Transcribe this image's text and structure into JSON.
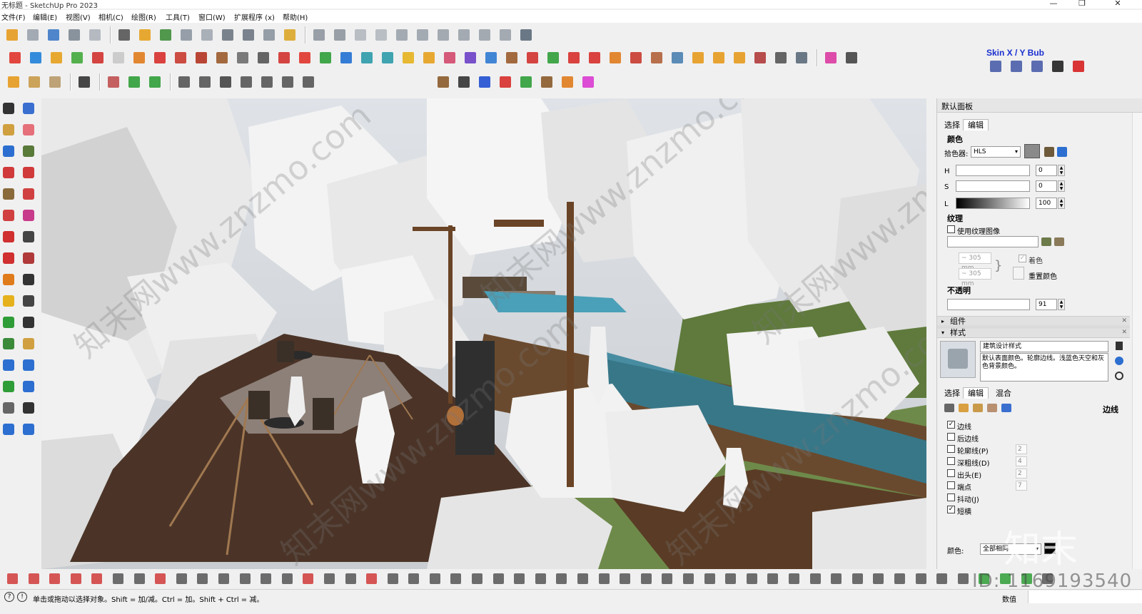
{
  "window": {
    "title": "无标题 - SketchUp Pro 2023",
    "minimize": "—",
    "maximize": "❐",
    "close": "✕"
  },
  "menu": [
    "文件(F)",
    "编辑(E)",
    "视图(V)",
    "相机(C)",
    "绘图(R)",
    "工具(T)",
    "窗口(W)",
    "扩展程序 (x)",
    "帮助(H)"
  ],
  "toolbar_skin_label": "Skin X / Y Bub",
  "tray": {
    "title": "默认面板",
    "material": {
      "tabs": [
        "选择",
        "编辑"
      ],
      "active_tab": "编辑",
      "section_color": "颜色",
      "picker_label": "拾色器:",
      "picker_value": "HLS",
      "h_label": "H",
      "h_value": "0",
      "s_label": "S",
      "s_value": "0",
      "l_label": "L",
      "l_value": "100",
      "section_texture": "纹理",
      "use_texture_label": "使用纹理图像",
      "tex_w": "~ 305 mm",
      "tex_h": "~ 305 mm",
      "colorize_label": "着色",
      "reset_color_label": "重置颜色",
      "section_opacity": "不透明",
      "opacity_value": "91"
    },
    "components_section": "组件",
    "styles_section": "样式",
    "style": {
      "name": "建筑设计样式",
      "description": "默认表面颜色。轮廓边线。浅蓝色天空和灰色背景颜色。",
      "tabs": [
        "选择",
        "编辑",
        "混合"
      ],
      "active_tab": "编辑",
      "edges_header": "边线",
      "options": [
        {
          "label": "边线",
          "checked": true,
          "value": ""
        },
        {
          "label": "后边线",
          "checked": false,
          "value": ""
        },
        {
          "label": "轮廓线(P)",
          "checked": false,
          "value": "2"
        },
        {
          "label": "深粗线(D)",
          "checked": false,
          "value": "4"
        },
        {
          "label": "出头(E)",
          "checked": false,
          "value": "2"
        },
        {
          "label": "端点",
          "checked": false,
          "value": "7"
        },
        {
          "label": "抖动(J)",
          "checked": false,
          "value": ""
        },
        {
          "label": "短横",
          "checked": true,
          "value": ""
        }
      ],
      "color_label": "颜色:",
      "color_value": "全部相同"
    }
  },
  "status": {
    "hint": "单击或拖动以选择对象。Shift = 加/减。Ctrl = 加。Shift + Ctrl = 减。",
    "measurements_label": "数值"
  },
  "overlay": {
    "id_text": "ID: 1169193540",
    "brand_text": "知末"
  },
  "watermarks": [
    "知末网www.znzmo.com",
    "知末网www.znzmo.com",
    "知末网www.znzmo.com",
    "知末网www.znzmo.com",
    "知末网www.znzmo.com"
  ]
}
